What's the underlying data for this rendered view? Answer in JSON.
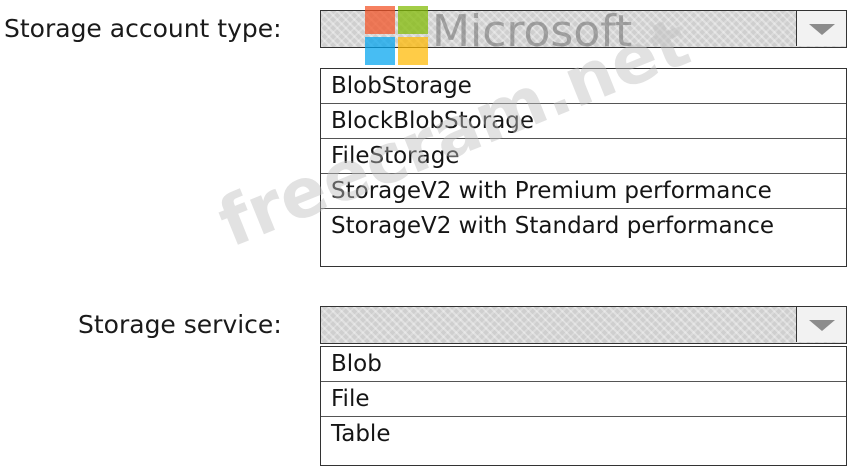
{
  "storage_account_type": {
    "label": "Storage account type:",
    "selected": "",
    "options": [
      "BlobStorage",
      "BlockBlobStorage",
      "FileStorage",
      "StorageV2 with Premium performance",
      "StorageV2 with Standard performance"
    ]
  },
  "storage_service": {
    "label": "Storage service:",
    "selected": "",
    "options": [
      "Blob",
      "File",
      "Table"
    ]
  },
  "watermarks": {
    "brand": "Microsoft",
    "site": "freecram.net"
  },
  "colors": {
    "dropdown_fill": "#cfcfcf",
    "border": "#333333",
    "arrow": "#8c8c8c",
    "ms_red": "#f25022",
    "ms_green": "#7fba00",
    "ms_blue": "#00a4ef",
    "ms_yellow": "#ffb900"
  },
  "icons": {
    "dropdown_arrow": "chevron-down-icon",
    "brand_logo": "microsoft-logo-icon"
  }
}
